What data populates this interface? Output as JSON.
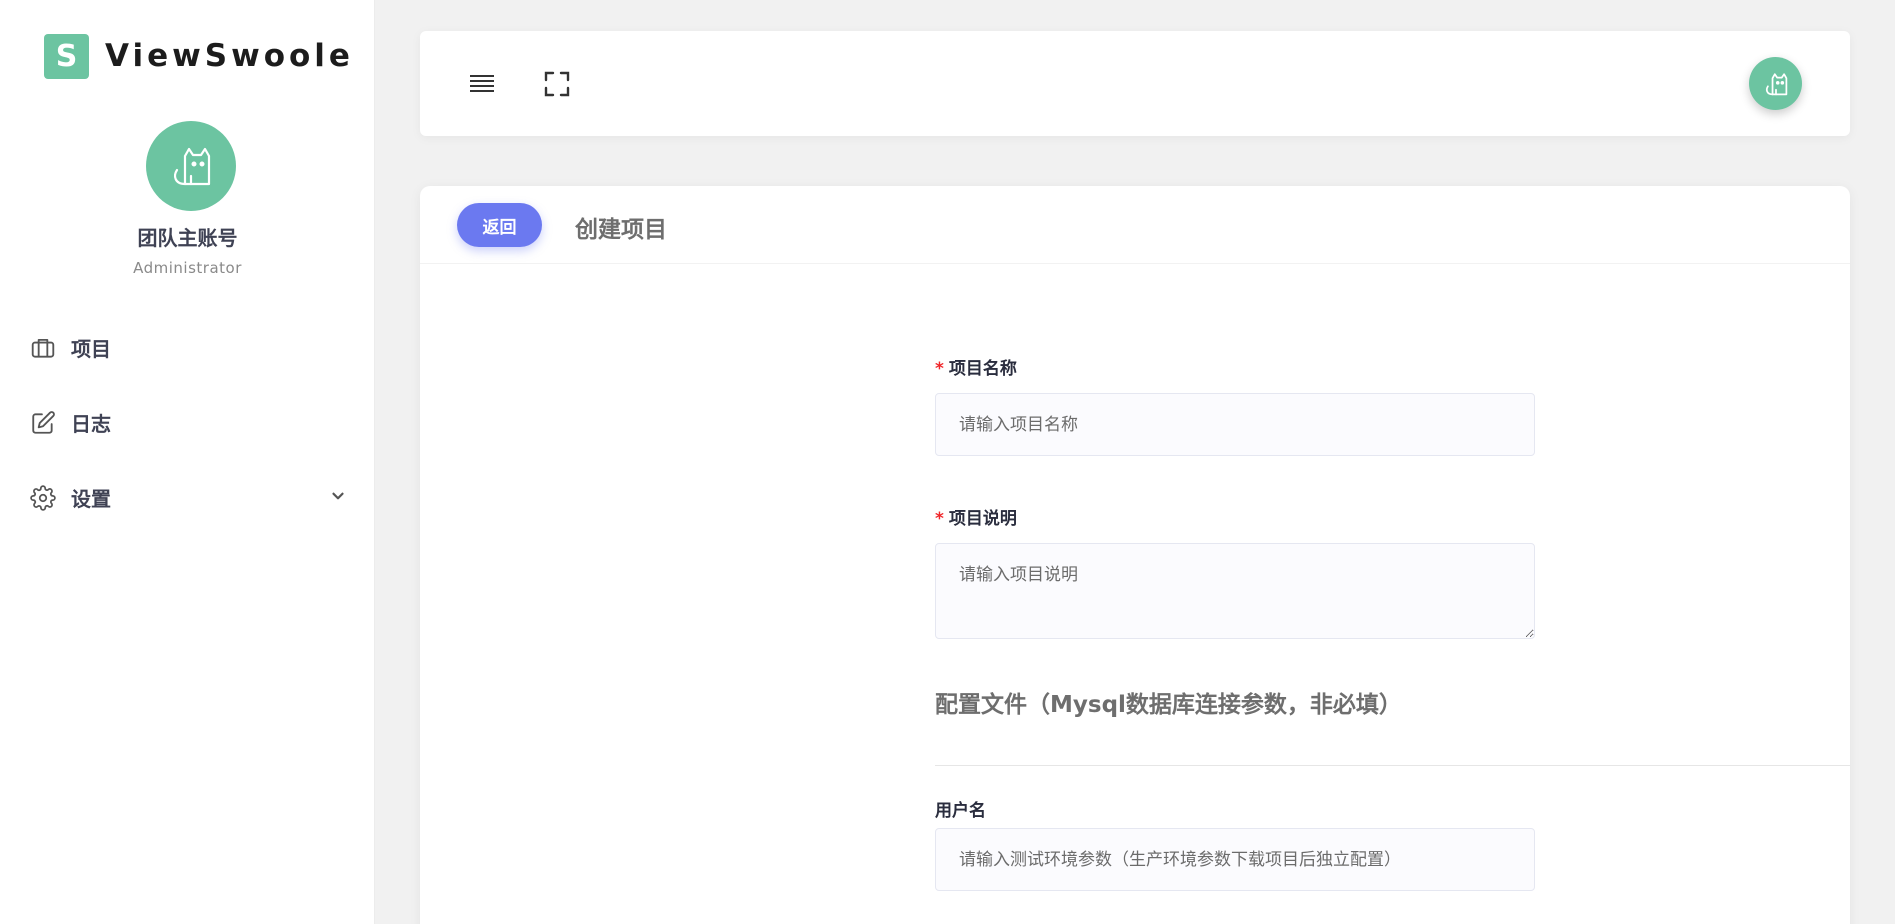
{
  "brand": {
    "logo_letter": "S",
    "name": "ViewSwoole"
  },
  "profile": {
    "name": "团队主账号",
    "role": "Administrator"
  },
  "nav": {
    "items": [
      {
        "label": "项目",
        "icon": "briefcase-icon"
      },
      {
        "label": "日志",
        "icon": "edit-icon"
      },
      {
        "label": "设置",
        "icon": "gear-icon"
      }
    ]
  },
  "colors": {
    "accent_green": "#6cc4a1",
    "primary_button": "#6b79f0",
    "required_star": "#f0262a"
  },
  "page": {
    "back_label": "返回",
    "title": "创建项目"
  },
  "form": {
    "required_mark": "*",
    "project_name": {
      "label": "项目名称",
      "placeholder": "请输入项目名称"
    },
    "project_desc": {
      "label": "项目说明",
      "placeholder": "请输入项目说明"
    },
    "config_section_title": "配置文件（Mysql数据库连接参数，非必填）",
    "username": {
      "label": "用户名",
      "placeholder": "请输入测试环境参数（生产环境参数下载项目后独立配置）"
    }
  }
}
